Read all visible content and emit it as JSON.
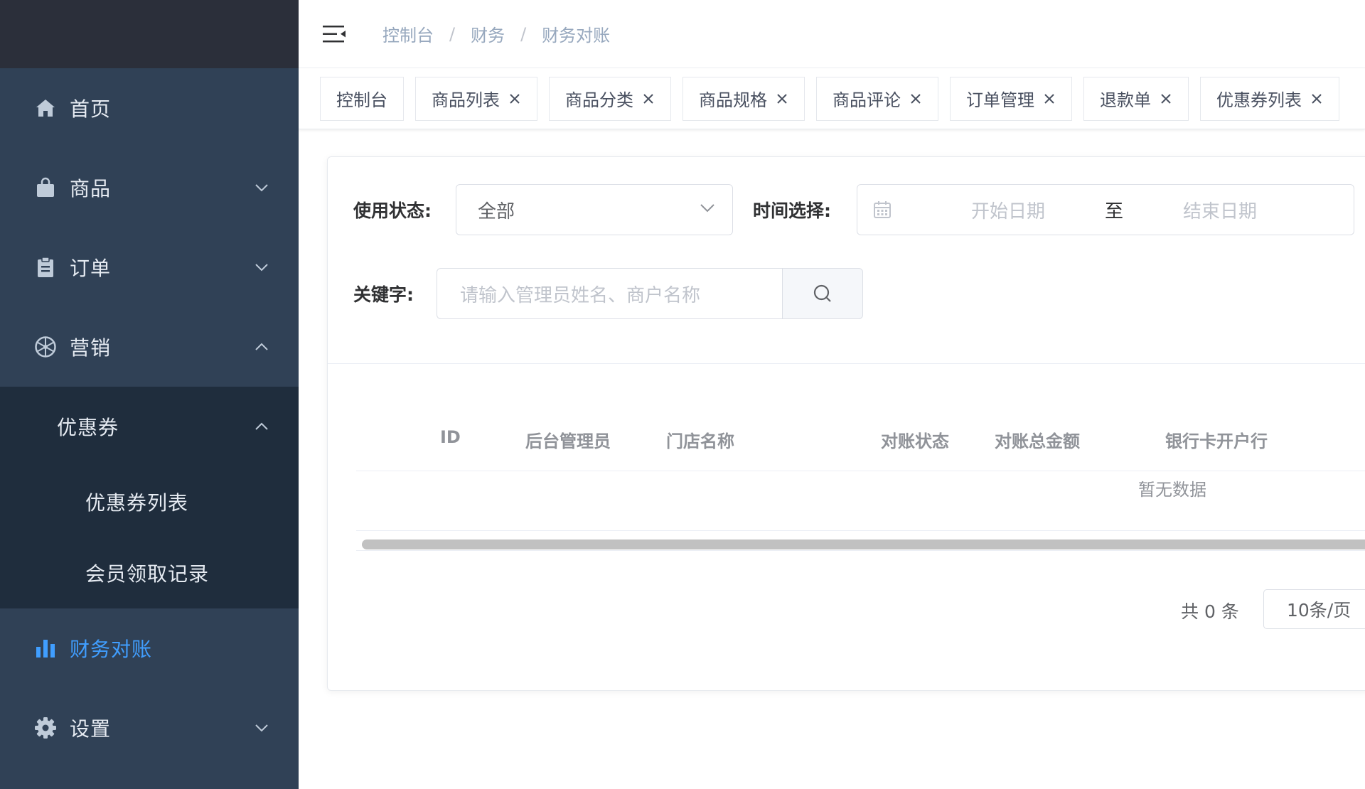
{
  "colors": {
    "sidebar_bg": "#304156",
    "submenu_bg": "#1f2d3d",
    "logo_bg": "#2b2f3a",
    "accent": "#409eff"
  },
  "sidebar": {
    "items": [
      {
        "label": "首页",
        "icon": "home-icon"
      },
      {
        "label": "商品",
        "icon": "bag-icon",
        "arrow": "chevron-down-icon"
      },
      {
        "label": "订单",
        "icon": "clipboard-icon",
        "arrow": "chevron-down-icon"
      },
      {
        "label": "营销",
        "icon": "marketing-icon",
        "arrow": "chevron-up-icon",
        "expanded": true,
        "children": [
          {
            "label": "优惠券",
            "arrow": "chevron-up-icon",
            "expanded": true,
            "children": [
              {
                "label": "优惠券列表"
              },
              {
                "label": "会员领取记录"
              }
            ]
          }
        ]
      },
      {
        "label": "财务对账",
        "icon": "bar-chart-icon",
        "active": true
      },
      {
        "label": "设置",
        "icon": "gear-icon",
        "arrow": "chevron-down-icon"
      }
    ]
  },
  "header": {
    "breadcrumb": [
      "控制台",
      "财务",
      "财务对账"
    ],
    "separator": "/"
  },
  "tags": [
    {
      "label": "控制台",
      "closable": false
    },
    {
      "label": "商品列表",
      "closable": true
    },
    {
      "label": "商品分类",
      "closable": true
    },
    {
      "label": "商品规格",
      "closable": true
    },
    {
      "label": "商品评论",
      "closable": true
    },
    {
      "label": "订单管理",
      "closable": true
    },
    {
      "label": "退款单",
      "closable": true
    },
    {
      "label": "优惠券列表",
      "closable": true
    }
  ],
  "filters": {
    "status_label": "使用状态:",
    "status_value": "全部",
    "time_label": "时间选择:",
    "start_placeholder": "开始日期",
    "range_separator": "至",
    "end_placeholder": "结束日期",
    "keyword_label": "关键字:",
    "keyword_placeholder": "请输入管理员姓名、商户名称"
  },
  "table": {
    "columns": [
      "ID",
      "后台管理员",
      "门店名称",
      "对账状态",
      "对账总金额",
      "银行卡开户行"
    ],
    "empty_text": "暂无数据"
  },
  "pagination": {
    "total_text": "共 0 条",
    "page_size": "10条/页"
  }
}
